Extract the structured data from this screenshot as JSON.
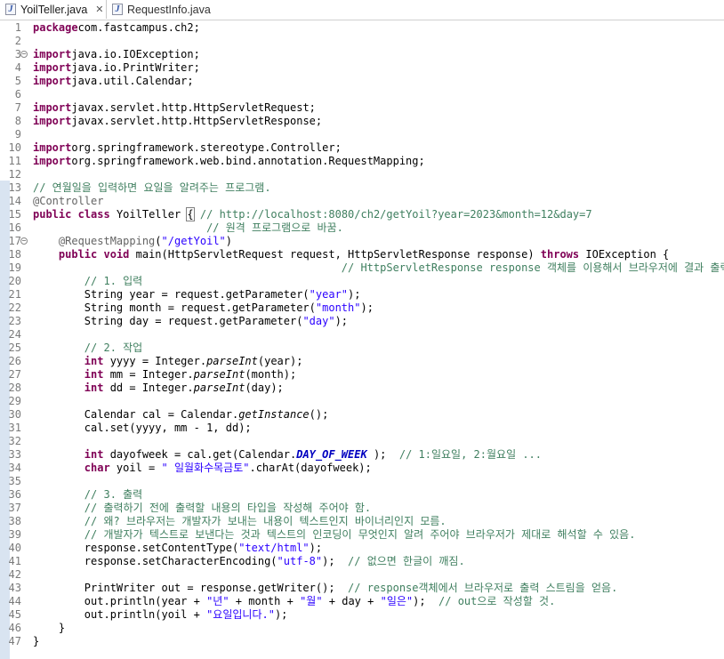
{
  "tabs": [
    {
      "label": "YoilTeller.java",
      "active": true,
      "icon": "java-file-icon",
      "close": "✕"
    },
    {
      "label": "RequestInfo.java",
      "active": false,
      "icon": "java-file-icon"
    }
  ],
  "colors": {
    "keyword": "#7f0055",
    "string": "#2a00ff",
    "comment": "#3f7f5f",
    "annotation": "#646464",
    "static_field": "#0000c0",
    "line_number": "#7a7a7a"
  },
  "lines": [
    {
      "n": "1",
      "segs": [
        [
          "k",
          "package"
        ],
        [
          "",
          "com.fastcampus.ch2;"
        ]
      ]
    },
    {
      "n": "2",
      "segs": []
    },
    {
      "n": "3",
      "fold": "minus",
      "segs": [
        [
          "k",
          "import"
        ],
        [
          "",
          "java.io.IOException;"
        ]
      ]
    },
    {
      "n": "4",
      "segs": [
        [
          "k",
          "import"
        ],
        [
          "",
          "java.io.PrintWriter;"
        ]
      ]
    },
    {
      "n": "5",
      "segs": [
        [
          "k",
          "import"
        ],
        [
          "",
          "java.util.Calendar;"
        ]
      ]
    },
    {
      "n": "6",
      "segs": []
    },
    {
      "n": "7",
      "segs": [
        [
          "k",
          "import"
        ],
        [
          "",
          "javax.servlet.http.HttpServletRequest;"
        ]
      ]
    },
    {
      "n": "8",
      "segs": [
        [
          "k",
          "import"
        ],
        [
          "",
          "javax.servlet.http.HttpServletResponse;"
        ]
      ]
    },
    {
      "n": "9",
      "segs": []
    },
    {
      "n": "10",
      "segs": [
        [
          "k",
          "import"
        ],
        [
          "",
          "org.springframework.stereotype.Controller;"
        ]
      ]
    },
    {
      "n": "11",
      "segs": [
        [
          "k",
          "import"
        ],
        [
          "",
          "org.springframework.web.bind.annotation.RequestMapping;"
        ]
      ]
    },
    {
      "n": "12",
      "segs": []
    },
    {
      "n": "13",
      "segs": [
        [
          "c",
          "// 연월일을 입력하면 요일을 알려주는 프로그램."
        ]
      ]
    },
    {
      "n": "14",
      "segs": [
        [
          "a",
          "@Controller"
        ]
      ]
    },
    {
      "n": "15",
      "segs": [
        [
          "k",
          "public"
        ],
        [
          "",
          " "
        ],
        [
          "k",
          "class"
        ],
        [
          "",
          "",
          " YoilTeller "
        ],
        [
          "box",
          "{"
        ],
        [
          "",
          " "
        ],
        [
          "c",
          "// http://localhost:8080/ch2/getYoil?year=2023&month=12&day=7"
        ]
      ]
    },
    {
      "n": "16",
      "segs": [
        [
          "",
          "                           "
        ],
        [
          "c",
          "// 원격 프로그램으로 바꿈."
        ]
      ]
    },
    {
      "n": "17",
      "fold": "minus",
      "segs": [
        [
          "",
          "    "
        ],
        [
          "a",
          "@RequestMapping"
        ],
        [
          "",
          "("
        ],
        [
          "s",
          "\"/getYoil\""
        ],
        [
          "",
          ")"
        ]
      ]
    },
    {
      "n": "18",
      "segs": [
        [
          "",
          "    "
        ],
        [
          "k",
          "public"
        ],
        [
          "",
          " "
        ],
        [
          "k",
          "void"
        ],
        [
          "",
          " main(HttpServletRequest request, HttpServletResponse response) "
        ],
        [
          "k",
          "throws"
        ],
        [
          "",
          " IOException {"
        ]
      ]
    },
    {
      "n": "19",
      "segs": [
        [
          "",
          "                                                "
        ],
        [
          "c",
          "// HttpServletResponse response 객체를 이용해서 브라우저에 결과 출력하기."
        ]
      ]
    },
    {
      "n": "20",
      "segs": [
        [
          "",
          "        "
        ],
        [
          "c",
          "// 1. 입력"
        ]
      ]
    },
    {
      "n": "21",
      "segs": [
        [
          "",
          "        String year = request.getParameter("
        ],
        [
          "s",
          "\"year\""
        ],
        [
          "",
          ");"
        ]
      ]
    },
    {
      "n": "22",
      "segs": [
        [
          "",
          "        String month = request.getParameter("
        ],
        [
          "s",
          "\"month\""
        ],
        [
          "",
          ");"
        ]
      ]
    },
    {
      "n": "23",
      "segs": [
        [
          "",
          "        String day = request.getParameter("
        ],
        [
          "s",
          "\"day\""
        ],
        [
          "",
          ");"
        ]
      ]
    },
    {
      "n": "24",
      "segs": []
    },
    {
      "n": "25",
      "segs": [
        [
          "",
          "        "
        ],
        [
          "c",
          "// 2. 작업"
        ]
      ]
    },
    {
      "n": "26",
      "segs": [
        [
          "",
          "        "
        ],
        [
          "k",
          "int"
        ],
        [
          "",
          " yyyy = Integer."
        ],
        [
          "i",
          "parseInt"
        ],
        [
          "",
          "(year);"
        ]
      ]
    },
    {
      "n": "27",
      "segs": [
        [
          "",
          "        "
        ],
        [
          "k",
          "int"
        ],
        [
          "",
          " mm = Integer."
        ],
        [
          "i",
          "parseInt"
        ],
        [
          "",
          "(month);"
        ]
      ]
    },
    {
      "n": "28",
      "segs": [
        [
          "",
          "        "
        ],
        [
          "k",
          "int"
        ],
        [
          "",
          " dd = Integer."
        ],
        [
          "i",
          "parseInt"
        ],
        [
          "",
          "(day);"
        ]
      ]
    },
    {
      "n": "29",
      "segs": []
    },
    {
      "n": "30",
      "segs": [
        [
          "",
          "        Calendar cal = Calendar."
        ],
        [
          "i",
          "getInstance"
        ],
        [
          "",
          "();"
        ]
      ]
    },
    {
      "n": "31",
      "segs": [
        [
          "",
          "        cal.set(yyyy, mm - 1, dd);"
        ]
      ]
    },
    {
      "n": "32",
      "segs": []
    },
    {
      "n": "33",
      "segs": [
        [
          "",
          "        "
        ],
        [
          "k",
          "int"
        ],
        [
          "",
          " dayofweek = cal.get(Calendar."
        ],
        [
          "f",
          "DAY_OF_WEEK"
        ],
        [
          "",
          " );  "
        ],
        [
          "c",
          "// 1:일요일, 2:월요일 ..."
        ]
      ]
    },
    {
      "n": "34",
      "segs": [
        [
          "",
          "        "
        ],
        [
          "k",
          "char"
        ],
        [
          "",
          " yoil = "
        ],
        [
          "s",
          "\" 일월화수목금토\""
        ],
        [
          "",
          ".charAt(dayofweek);"
        ]
      ]
    },
    {
      "n": "35",
      "segs": []
    },
    {
      "n": "36",
      "segs": [
        [
          "",
          "        "
        ],
        [
          "c",
          "// 3. 출력"
        ]
      ]
    },
    {
      "n": "37",
      "segs": [
        [
          "",
          "        "
        ],
        [
          "c",
          "// 출력하기 전에 출력할 내용의 타입을 작성해 주어야 함."
        ]
      ]
    },
    {
      "n": "38",
      "segs": [
        [
          "",
          "        "
        ],
        [
          "c",
          "// 왜? 브라우저는 개발자가 보내는 내용이 텍스트인지 바이너리인지 모름."
        ]
      ]
    },
    {
      "n": "39",
      "segs": [
        [
          "",
          "        "
        ],
        [
          "c",
          "// 개발자가 텍스트로 보낸다는 것과 텍스트의 인코딩이 무엇인지 알려 주어야 브라우저가 제대로 해석할 수 있음."
        ]
      ]
    },
    {
      "n": "40",
      "segs": [
        [
          "",
          "        response.setContentType("
        ],
        [
          "s",
          "\"text/html\""
        ],
        [
          "",
          ");"
        ]
      ]
    },
    {
      "n": "41",
      "segs": [
        [
          "",
          "        response.setCharacterEncoding("
        ],
        [
          "s",
          "\"utf-8\""
        ],
        [
          "",
          ");  "
        ],
        [
          "c",
          "// 없으면 한글이 깨짐."
        ]
      ]
    },
    {
      "n": "42",
      "segs": []
    },
    {
      "n": "43",
      "segs": [
        [
          "",
          "        PrintWriter out = response.getWriter();  "
        ],
        [
          "c",
          "// response객체에서 브라우저로 출력 스트림을 얻음."
        ]
      ]
    },
    {
      "n": "44",
      "segs": [
        [
          "",
          "        out.println(year + "
        ],
        [
          "s",
          "\"년\""
        ],
        [
          "",
          " + month + "
        ],
        [
          "s",
          "\"월\""
        ],
        [
          "",
          " + day + "
        ],
        [
          "s",
          "\"일은\""
        ],
        [
          "",
          ");  "
        ],
        [
          "c",
          "// out으로 작성할 것."
        ]
      ]
    },
    {
      "n": "45",
      "segs": [
        [
          "",
          "        out.println(yoil + "
        ],
        [
          "s",
          "\"요일입니다.\""
        ],
        [
          "",
          ");"
        ]
      ]
    },
    {
      "n": "46",
      "segs": [
        [
          "",
          "    }"
        ]
      ]
    },
    {
      "n": "47",
      "segs": [
        [
          "",
          "}"
        ]
      ]
    }
  ]
}
